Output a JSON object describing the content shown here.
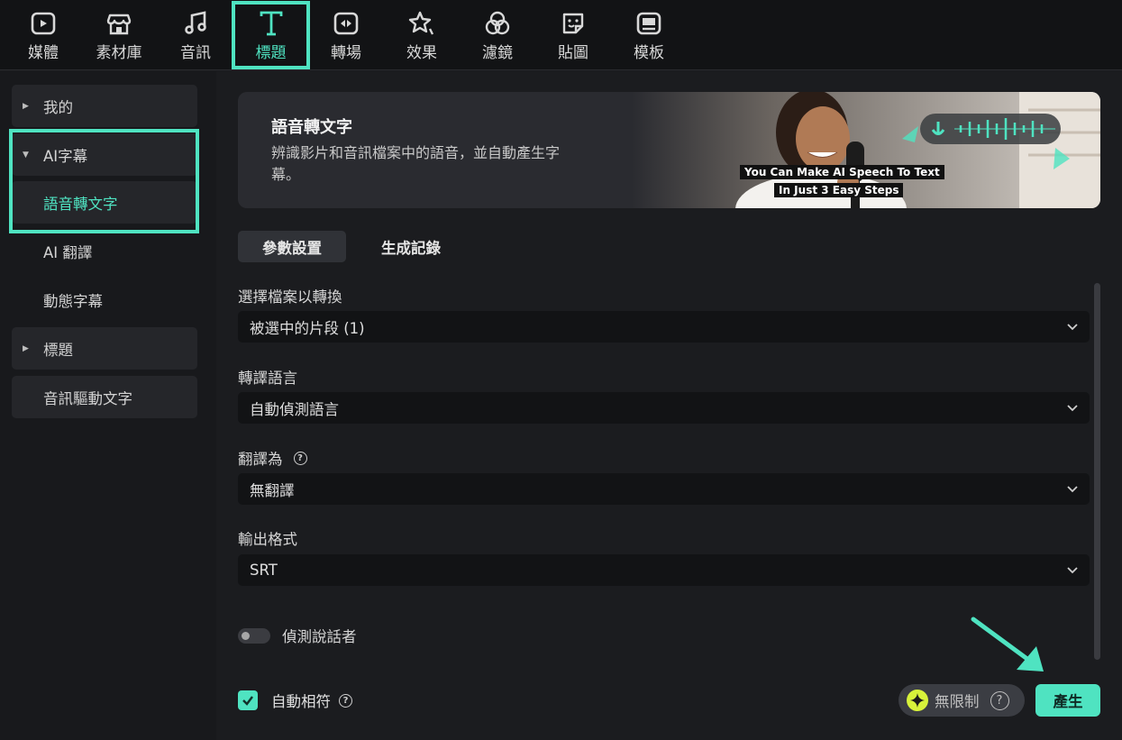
{
  "toolbar": {
    "tabs": [
      {
        "label": "媒體",
        "icon": "media-icon"
      },
      {
        "label": "素材庫",
        "icon": "store-icon"
      },
      {
        "label": "音訊",
        "icon": "music-note-icon"
      },
      {
        "label": "標題",
        "icon": "title-t-icon",
        "active": true
      },
      {
        "label": "轉場",
        "icon": "transition-icon"
      },
      {
        "label": "效果",
        "icon": "effects-star-icon"
      },
      {
        "label": "濾鏡",
        "icon": "filter-icon"
      },
      {
        "label": "貼圖",
        "icon": "sticker-icon"
      },
      {
        "label": "模板",
        "icon": "template-icon"
      }
    ]
  },
  "sidebar": {
    "items": [
      {
        "label": "我的"
      },
      {
        "label": "AI字幕"
      },
      {
        "label": "語音轉文字"
      },
      {
        "label": "AI 翻譯"
      },
      {
        "label": "動態字幕"
      },
      {
        "label": "標題"
      },
      {
        "label": "音訊驅動文字"
      }
    ]
  },
  "banner": {
    "title": "語音轉文字",
    "description": "辨識影片和音訊檔案中的語音，並自動產生字幕。",
    "caption_line1": "You Can Make AI Speech To Text",
    "caption_line2": "In Just  3 Easy Steps"
  },
  "tabs": {
    "params": "參數設置",
    "history": "生成記錄"
  },
  "form": {
    "file_label": "選擇檔案以轉換",
    "file_value": "被選中的片段 (1)",
    "language_label": "轉譯語言",
    "language_value": "自動偵測語言",
    "translate_label": "翻譯為",
    "translate_value": "無翻譯",
    "format_label": "輸出格式",
    "format_value": "SRT",
    "speaker_label": "偵測說話者",
    "auto_match_label": "自動相符"
  },
  "footer": {
    "unlimited_label": "無限制",
    "generate_label": "產生"
  },
  "colors": {
    "accent": "#4fe3c1",
    "background": "#1b1c1f",
    "toolbar": "#121315"
  }
}
